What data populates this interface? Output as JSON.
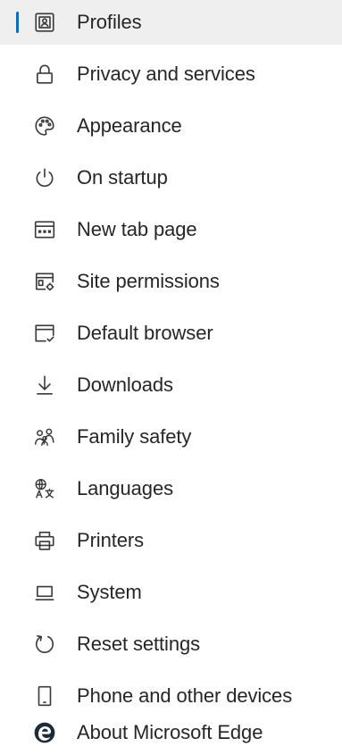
{
  "sidebar": {
    "items": [
      {
        "label": "Profiles",
        "icon": "profile-card-icon",
        "selected": true
      },
      {
        "label": "Privacy and services",
        "icon": "lock-icon",
        "selected": false
      },
      {
        "label": "Appearance",
        "icon": "palette-icon",
        "selected": false
      },
      {
        "label": "On startup",
        "icon": "power-icon",
        "selected": false
      },
      {
        "label": "New tab page",
        "icon": "new-tab-page-icon",
        "selected": false
      },
      {
        "label": "Site permissions",
        "icon": "site-permissions-icon",
        "selected": false
      },
      {
        "label": "Default browser",
        "icon": "default-browser-icon",
        "selected": false
      },
      {
        "label": "Downloads",
        "icon": "download-icon",
        "selected": false
      },
      {
        "label": "Family safety",
        "icon": "family-icon",
        "selected": false
      },
      {
        "label": "Languages",
        "icon": "languages-icon",
        "selected": false
      },
      {
        "label": "Printers",
        "icon": "printer-icon",
        "selected": false
      },
      {
        "label": "System",
        "icon": "laptop-icon",
        "selected": false
      },
      {
        "label": "Reset settings",
        "icon": "reset-icon",
        "selected": false
      },
      {
        "label": "Phone and other devices",
        "icon": "phone-icon",
        "selected": false
      },
      {
        "label": "About Microsoft Edge",
        "icon": "edge-logo-icon",
        "selected": false
      }
    ]
  },
  "colors": {
    "accent": "#0f6cbd",
    "selected_background": "#efefef",
    "text": "#262626",
    "icon": "#3a3a3a"
  }
}
